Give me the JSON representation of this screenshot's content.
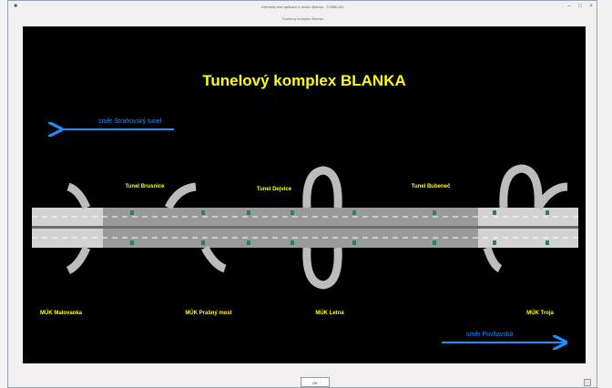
{
  "window": {
    "title_primary": "Klientský test aplikace k tunelu Blanka - TUNBLAN",
    "title_secondary": "Tunelový komplex Blanka",
    "ok_label": "OK"
  },
  "scheme": {
    "title": "Tunelový komplex BLANKA",
    "direction_left": "směr Strahovský tunel",
    "direction_right": "směr Povltavská",
    "tunnels": [
      "Tunel Brusnice",
      "Tunel Dejvice",
      "Tunel Bubeneč"
    ],
    "junctions": [
      "MÚK Malovanka",
      "MÚK Prašný most",
      "MÚK Letná",
      "MÚK Troja"
    ],
    "colors": {
      "title": "#ffff00",
      "labels": "#ffff00",
      "arrows": "#1e90ff",
      "road": "#cfcfcf",
      "tunnel": "#9a9a9a",
      "background": "#000000"
    }
  }
}
